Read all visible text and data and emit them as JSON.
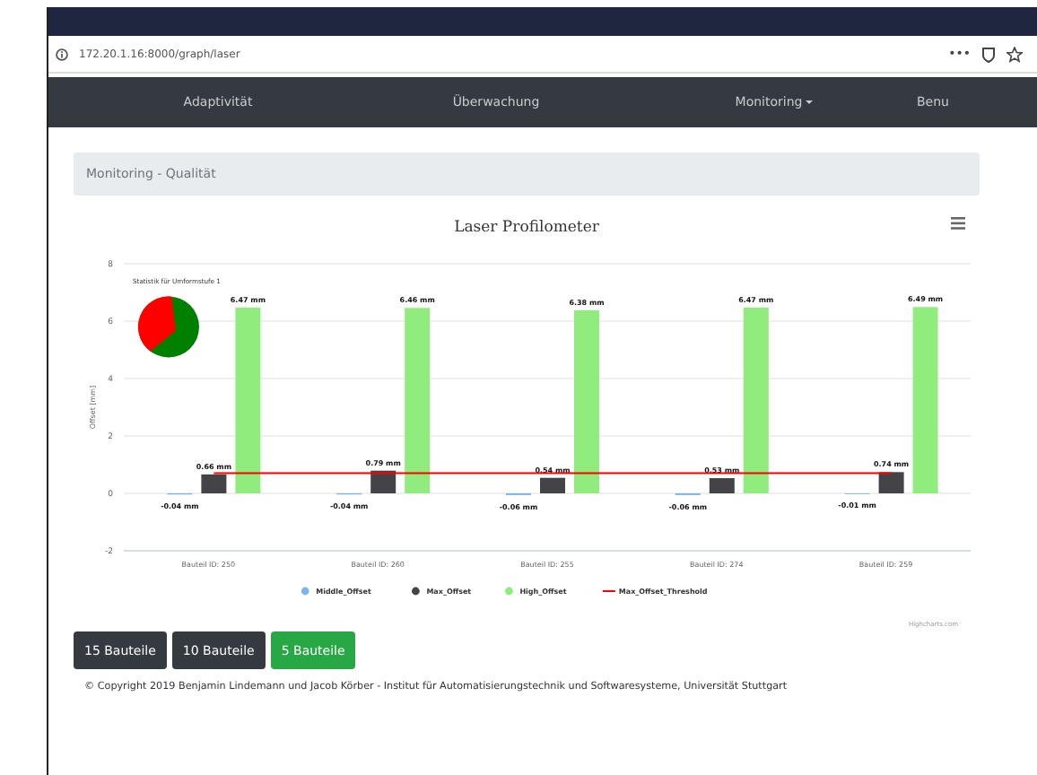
{
  "browser": {
    "url": "172.20.1.16:8000/graph/laser",
    "menu": "•••"
  },
  "nav": {
    "items": [
      {
        "label": "Adaptivität",
        "dropdown": false
      },
      {
        "label": "Überwachung",
        "dropdown": false
      },
      {
        "label": "Monitoring",
        "dropdown": true
      },
      {
        "label": "Benu",
        "dropdown": false
      }
    ]
  },
  "breadcrumb": "Monitoring - Qualität",
  "chart": {
    "credits": "Highcharts.com",
    "inset": {
      "title": "Statistik für Umformstufe 1"
    },
    "chart_data": {
      "type": "bar",
      "title": "Laser Profilometer",
      "ylabel": "Offset [mm]",
      "categories": [
        "Bauteil ID: 250",
        "Bauteil ID: 260",
        "Bauteil ID: 255",
        "Bauteil ID: 274",
        "Bauteil ID: 259"
      ],
      "series": [
        {
          "name": "Middle_Offset",
          "color": "#7cb5ec",
          "type": "bar",
          "values": [
            -0.04,
            -0.04,
            -0.06,
            -0.06,
            -0.01
          ]
        },
        {
          "name": "Max_Offset",
          "color": "#434348",
          "type": "bar",
          "values": [
            0.66,
            0.79,
            0.54,
            0.53,
            0.74
          ]
        },
        {
          "name": "High_Offset",
          "color": "#90ed7d",
          "type": "bar",
          "values": [
            6.47,
            6.46,
            6.38,
            6.47,
            6.49
          ]
        },
        {
          "name": "Max_Offset_Threshold",
          "color": "#ff0000",
          "type": "line",
          "values": [
            0.7,
            0.7,
            0.7,
            0.7,
            0.7
          ]
        }
      ],
      "ylim": [
        -2,
        8
      ],
      "yticks": [
        -2,
        0,
        2,
        4,
        6,
        8
      ],
      "grid": true,
      "legend": "bottom",
      "value_labels": [
        [
          "-0.04 mm",
          "-0.04 mm",
          "-0.06 mm",
          "-0.06 mm",
          "-0.01 mm"
        ],
        [
          "0.66 mm",
          "0.79 mm",
          "0.54 mm",
          "0.53 mm",
          "0.74 mm"
        ],
        [
          "6.47 mm",
          "6.46 mm",
          "6.38 mm",
          "6.47 mm",
          "6.49 mm"
        ],
        null
      ]
    }
  },
  "buttons": [
    {
      "label": "15 Bauteile",
      "selected": false
    },
    {
      "label": "10 Bauteile",
      "selected": false
    },
    {
      "label": "5 Bauteile",
      "selected": true
    }
  ],
  "footer": "© Copyright 2019 Benjamin Lindemann und Jacob Körber - Institut für Automatisierungstechnik und Softwaresysteme, Universität Stuttgart"
}
